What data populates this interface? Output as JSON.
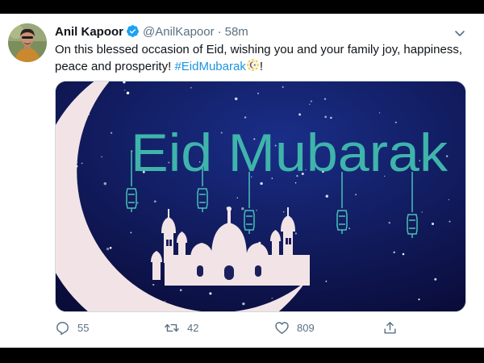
{
  "tweet": {
    "author_name": "Anil Kapoor",
    "handle": "@AnilKapoor",
    "separator": "·",
    "time": "58m",
    "text_before": "On this blessed occasion of Eid, wishing you and your family joy, happiness, peace and prosperity! ",
    "hashtag": "#EidMubarak",
    "text_after": "!",
    "emoji": "crescent-star-emoji",
    "verified_icon": "verified-badge-icon",
    "menu_icon": "chevron-down-icon"
  },
  "media": {
    "headline": "Eid Mubarak",
    "colors": {
      "sky_top": "#1a2e88",
      "sky_bottom": "#0a0c3a",
      "moon": "#f2e4e6",
      "text": "#3fb4ab",
      "lantern": "#4ac0b8"
    }
  },
  "actions": {
    "reply": {
      "icon": "reply-icon",
      "count": "55"
    },
    "retweet": {
      "icon": "retweet-icon",
      "count": "42"
    },
    "like": {
      "icon": "heart-icon",
      "count": "809"
    },
    "share": {
      "icon": "share-icon",
      "count": ""
    }
  },
  "colors": {
    "verified": "#1da1f2",
    "hashtag": "#1b95e0",
    "secondary_text": "#5b7083"
  }
}
